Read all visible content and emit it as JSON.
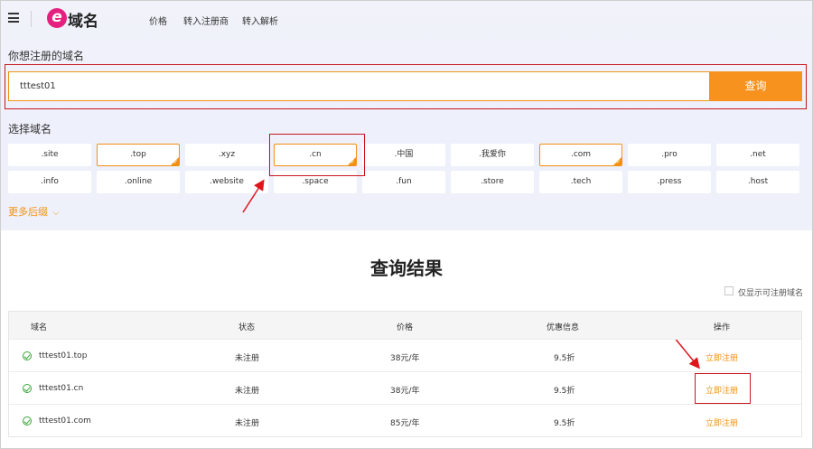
{
  "header": {
    "logo_text": "域名",
    "logo_letter": "e",
    "nav": [
      "价格",
      "转入注册商",
      "转入解析"
    ]
  },
  "search": {
    "label": "你想注册的域名",
    "value": "tttest01",
    "button": "查询"
  },
  "select": {
    "label": "选择域名",
    "row1": [
      {
        "label": ".site",
        "selected": false
      },
      {
        "label": ".top",
        "selected": true
      },
      {
        "label": ".xyz",
        "selected": false
      },
      {
        "label": ".cn",
        "selected": true
      },
      {
        "label": ".中国",
        "selected": false
      },
      {
        "label": ".我爱你",
        "selected": false
      },
      {
        "label": ".com",
        "selected": true
      },
      {
        "label": ".pro",
        "selected": false
      },
      {
        "label": ".net",
        "selected": false
      }
    ],
    "row2": [
      {
        "label": ".info",
        "selected": false
      },
      {
        "label": ".online",
        "selected": false
      },
      {
        "label": ".website",
        "selected": false
      },
      {
        "label": ".space",
        "selected": false
      },
      {
        "label": ".fun",
        "selected": false
      },
      {
        "label": ".store",
        "selected": false
      },
      {
        "label": ".tech",
        "selected": false
      },
      {
        "label": ".press",
        "selected": false
      },
      {
        "label": ".host",
        "selected": false
      }
    ],
    "more": "更多后缀"
  },
  "results": {
    "title": "查询结果",
    "only_available_label": "仅显示可注册域名",
    "columns": [
      "域名",
      "状态",
      "价格",
      "优惠信息",
      "操作"
    ],
    "rows": [
      {
        "domain": "tttest01.top",
        "status": "未注册",
        "price": "38元/年",
        "discount": "9.5折",
        "action": "立即注册"
      },
      {
        "domain": "tttest01.cn",
        "status": "未注册",
        "price": "38元/年",
        "discount": "9.5折",
        "action": "立即注册"
      },
      {
        "domain": "tttest01.com",
        "status": "未注册",
        "price": "85元/年",
        "discount": "9.5折",
        "action": "立即注册"
      }
    ]
  },
  "colors": {
    "accent": "#f7921e",
    "annotation": "#c8181e",
    "ok": "#3aa53a"
  }
}
